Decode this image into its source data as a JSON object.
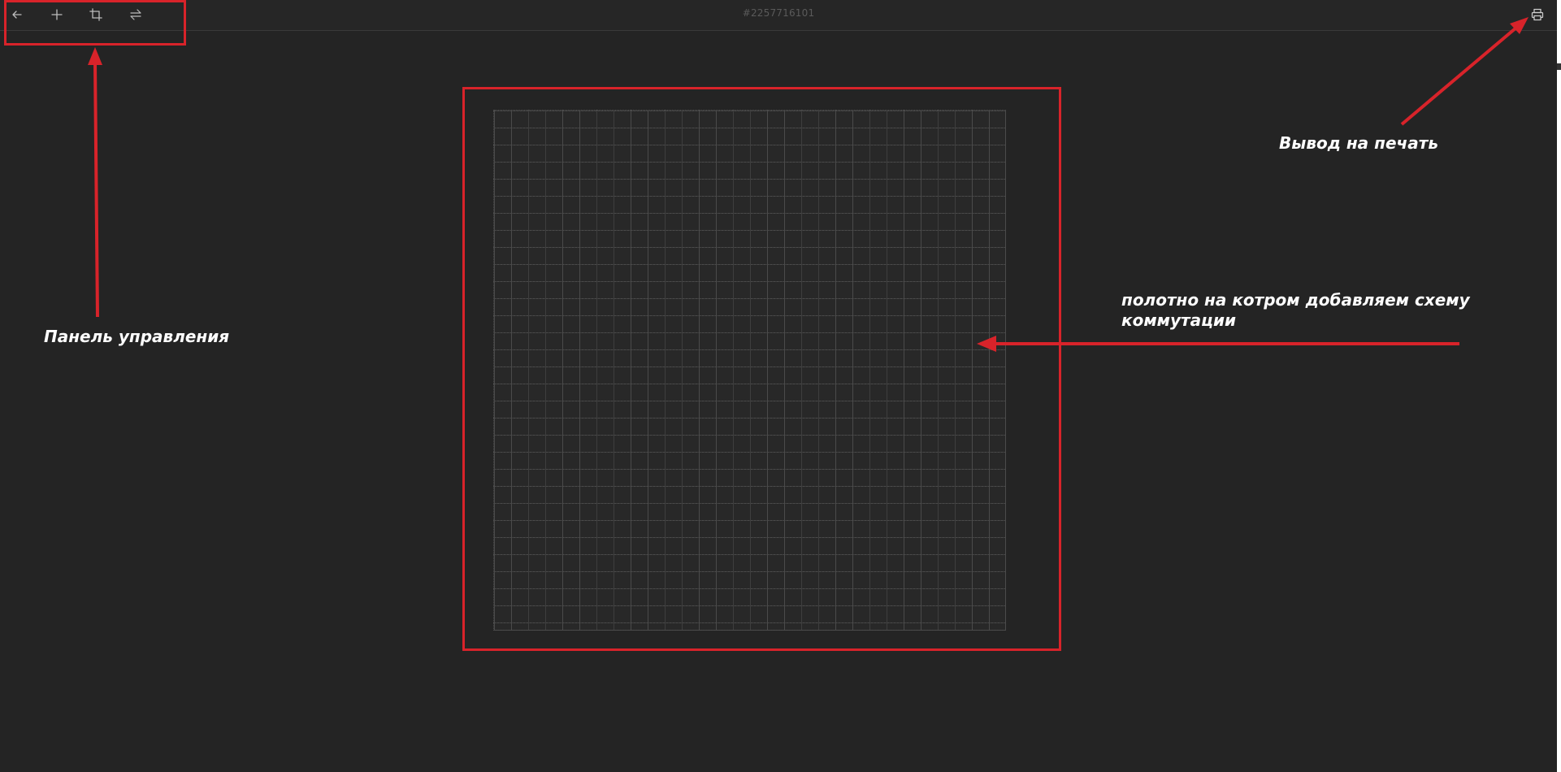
{
  "toolbar": {
    "document_id": "#2257716101",
    "buttons": [
      {
        "name": "back",
        "icon": "arrow-left-icon"
      },
      {
        "name": "add",
        "icon": "plus-icon"
      },
      {
        "name": "crop",
        "icon": "crop-icon"
      },
      {
        "name": "swap",
        "icon": "swap-arrows-icon"
      }
    ],
    "print_icon": "printer-icon"
  },
  "annotations": {
    "control_panel": "Панель управления",
    "print_output": "Вывод на печать",
    "canvas_line1": "полотно на котром добавляем схему",
    "canvas_line2": "коммутации"
  },
  "colors": {
    "background": "#242424",
    "toolbar": "#262626",
    "annotation_red": "#d8232a",
    "annotation_text": "#ffffff",
    "icon": "#bdbdbd"
  }
}
